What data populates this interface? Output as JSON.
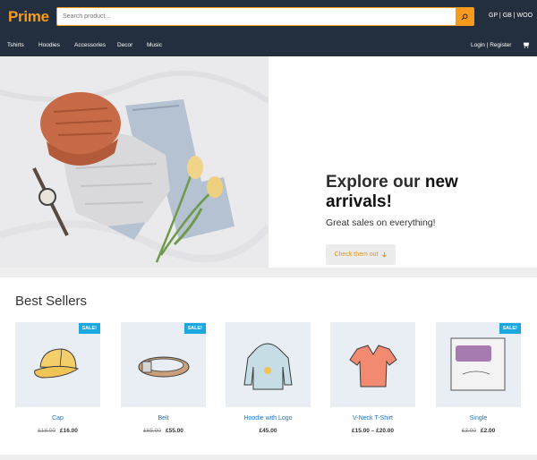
{
  "header": {
    "logo": "Prime",
    "search_placeholder": "Search product...",
    "langs": "GP | GB | WOO"
  },
  "nav": {
    "items": [
      "Tshirts",
      "Hoodies",
      "Accessories",
      "Decor",
      "Music"
    ],
    "login": "Login | Register"
  },
  "hero": {
    "title_plain": "Explore our ",
    "title_strong": "new arrivals!",
    "subtitle": "Great sales on everything!",
    "button": "Check them out"
  },
  "best_sellers": {
    "title": "Best Sellers",
    "sale_badge": "SALE!",
    "products": [
      {
        "name": "Cap",
        "old_price": "£18.00",
        "price": "£16.00",
        "sale": true
      },
      {
        "name": "Belt",
        "old_price": "£65.00",
        "price": "£55.00",
        "sale": true
      },
      {
        "name": "Hoodie with Logo",
        "old_price": "",
        "price": "£45.00",
        "sale": false
      },
      {
        "name": "V-Neck T-Shirt",
        "old_price": "",
        "price": "£15.00 – £20.00",
        "sale": false
      },
      {
        "name": "Single",
        "old_price": "£3.00",
        "price": "£2.00",
        "sale": true
      }
    ]
  },
  "colors": {
    "header_bg": "#232f3e",
    "accent": "#f79b1f",
    "sale_badge": "#1ba8e0",
    "link": "#1a73c7"
  }
}
